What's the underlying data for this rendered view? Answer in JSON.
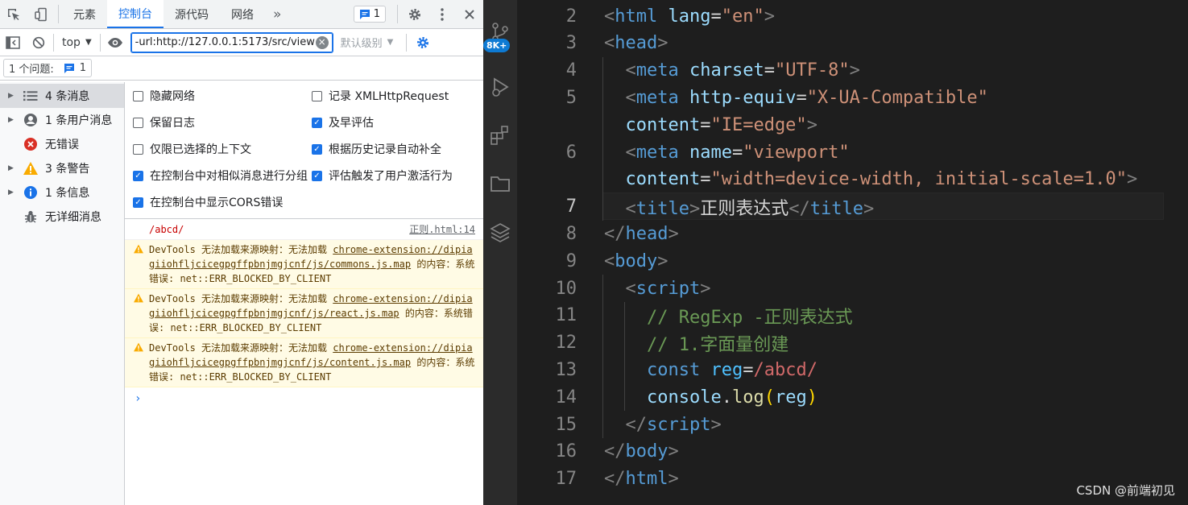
{
  "devtools": {
    "tabs": [
      "元素",
      "控制台",
      "源代码",
      "网络"
    ],
    "active_tab": "控制台",
    "more_tabs_label": "»",
    "issues_badge_count": "1",
    "toolbar": {
      "context_label": "top",
      "filter_value": "-url:http://127.0.0.1:5173/src/view",
      "levels_label": "默认级别"
    },
    "issues_bar": {
      "label": "1 个问题:",
      "count": "1"
    },
    "sidebar": {
      "items": [
        {
          "label": "4 条消息",
          "icon": "list-icon"
        },
        {
          "label": "1 条用户消息",
          "icon": "user-icon"
        },
        {
          "label": "无错误",
          "icon": "error-icon"
        },
        {
          "label": "3 条警告",
          "icon": "warning-icon"
        },
        {
          "label": "1 条信息",
          "icon": "info-icon"
        },
        {
          "label": "无详细消息",
          "icon": "bug-icon"
        }
      ]
    },
    "settings": [
      {
        "label": "隐藏网络",
        "checked": false
      },
      {
        "label": "记录 XMLHttpRequest",
        "checked": false
      },
      {
        "label": "保留日志",
        "checked": false
      },
      {
        "label": "及早评估",
        "checked": true
      },
      {
        "label": "仅限已选择的上下文",
        "checked": false
      },
      {
        "label": "根据历史记录自动补全",
        "checked": true
      },
      {
        "label": "在控制台中对相似消息进行分组",
        "checked": true
      },
      {
        "label": "评估触发了用户激活行为",
        "checked": true
      },
      {
        "label": "在控制台中显示CORS错误",
        "checked": true
      }
    ],
    "console": {
      "log": {
        "text": "/abcd/",
        "source": "正则.html:14"
      },
      "warnings": [
        {
          "prefix": "DevTools 无法加载来源映射：无法加载 ",
          "url": "chrome-extension://dipiagiiohfljcicegpgffpbnjmgjcnf/js/commons.js.map",
          "suffix": " 的内容：系统错误: net::ERR_BLOCKED_BY_CLIENT"
        },
        {
          "prefix": "DevTools 无法加载来源映射：无法加载 ",
          "url": "chrome-extension://dipiagiiohfljcicegpgffpbnjmgjcnf/js/react.js.map",
          "suffix": " 的内容：系统错误: net::ERR_BLOCKED_BY_CLIENT"
        },
        {
          "prefix": "DevTools 无法加载来源映射：无法加载 ",
          "url": "chrome-extension://dipiagiiohfljcicegpgffpbnjmgjcnf/js/content.js.map",
          "suffix": " 的内容：系统错误: net::ERR_BLOCKED_BY_CLIENT"
        }
      ],
      "prompt": "›"
    }
  },
  "activity_bar": {
    "badge": "8K+"
  },
  "editor": {
    "current_line": 7,
    "lines": [
      {
        "num": "2",
        "tokens": [
          [
            "p",
            "<"
          ],
          [
            "t",
            "html"
          ],
          [
            "w",
            " "
          ],
          [
            "a",
            "lang"
          ],
          [
            "w",
            "="
          ],
          [
            "s",
            "\"en\""
          ],
          [
            "p",
            ">"
          ]
        ]
      },
      {
        "num": "3",
        "tokens": [
          [
            "p",
            "<"
          ],
          [
            "t",
            "head"
          ],
          [
            "p",
            ">"
          ]
        ]
      },
      {
        "num": "4",
        "tokens": [
          [
            "w",
            "  "
          ],
          [
            "p",
            "<"
          ],
          [
            "t",
            "meta"
          ],
          [
            "w",
            " "
          ],
          [
            "a",
            "charset"
          ],
          [
            "w",
            "="
          ],
          [
            "s",
            "\"UTF-8\""
          ],
          [
            "p",
            ">"
          ]
        ]
      },
      {
        "num": "5",
        "tokens": [
          [
            "w",
            "  "
          ],
          [
            "p",
            "<"
          ],
          [
            "t",
            "meta"
          ],
          [
            "w",
            " "
          ],
          [
            "a",
            "http-equiv"
          ],
          [
            "w",
            "="
          ],
          [
            "s",
            "\"X-UA-Compatible\""
          ]
        ]
      },
      {
        "num": "",
        "tokens": [
          [
            "w",
            "  "
          ],
          [
            "a",
            "content"
          ],
          [
            "w",
            "="
          ],
          [
            "s",
            "\"IE=edge\""
          ],
          [
            "p",
            ">"
          ]
        ]
      },
      {
        "num": "6",
        "tokens": [
          [
            "w",
            "  "
          ],
          [
            "p",
            "<"
          ],
          [
            "t",
            "meta"
          ],
          [
            "w",
            " "
          ],
          [
            "a",
            "name"
          ],
          [
            "w",
            "="
          ],
          [
            "s",
            "\"viewport\""
          ]
        ]
      },
      {
        "num": "",
        "tokens": [
          [
            "w",
            "  "
          ],
          [
            "a",
            "content"
          ],
          [
            "w",
            "="
          ],
          [
            "s",
            "\"width=device-width, initial-scale=1.0\""
          ],
          [
            "p",
            ">"
          ]
        ]
      },
      {
        "num": "7",
        "tokens": [
          [
            "w",
            "  "
          ],
          [
            "p",
            "<"
          ],
          [
            "t",
            "title"
          ],
          [
            "p",
            ">"
          ],
          [
            "w",
            "正则表达式"
          ],
          [
            "p",
            "</"
          ],
          [
            "t",
            "title"
          ],
          [
            "p",
            ">"
          ]
        ]
      },
      {
        "num": "8",
        "tokens": [
          [
            "p",
            "</"
          ],
          [
            "t",
            "head"
          ],
          [
            "p",
            ">"
          ]
        ]
      },
      {
        "num": "9",
        "tokens": [
          [
            "p",
            "<"
          ],
          [
            "t",
            "body"
          ],
          [
            "p",
            ">"
          ]
        ]
      },
      {
        "num": "10",
        "tokens": [
          [
            "w",
            "  "
          ],
          [
            "p",
            "<"
          ],
          [
            "t",
            "script"
          ],
          [
            "p",
            ">"
          ]
        ]
      },
      {
        "num": "11",
        "tokens": [
          [
            "w",
            "    "
          ],
          [
            "c",
            "// RegExp -正则表达式"
          ]
        ]
      },
      {
        "num": "12",
        "tokens": [
          [
            "w",
            "    "
          ],
          [
            "c",
            "// 1.字面量创建"
          ]
        ]
      },
      {
        "num": "13",
        "tokens": [
          [
            "w",
            "    "
          ],
          [
            "k",
            "const"
          ],
          [
            "w",
            " "
          ],
          [
            "v",
            "reg"
          ],
          [
            "w",
            "="
          ],
          [
            "r",
            "/abcd/"
          ]
        ]
      },
      {
        "num": "14",
        "tokens": [
          [
            "w",
            "    "
          ],
          [
            "a",
            "console"
          ],
          [
            "w",
            "."
          ],
          [
            "f",
            "log"
          ],
          [
            "br",
            "("
          ],
          [
            "a",
            "reg"
          ],
          [
            "br",
            ")"
          ]
        ]
      },
      {
        "num": "15",
        "tokens": [
          [
            "w",
            "  "
          ],
          [
            "p",
            "</"
          ],
          [
            "t",
            "script"
          ],
          [
            "p",
            ">"
          ]
        ]
      },
      {
        "num": "16",
        "tokens": [
          [
            "p",
            "</"
          ],
          [
            "t",
            "body"
          ],
          [
            "p",
            ">"
          ]
        ]
      },
      {
        "num": "17",
        "tokens": [
          [
            "p",
            "</"
          ],
          [
            "t",
            "html"
          ],
          [
            "p",
            ">"
          ]
        ]
      }
    ]
  },
  "watermark": "CSDN @前端初见"
}
